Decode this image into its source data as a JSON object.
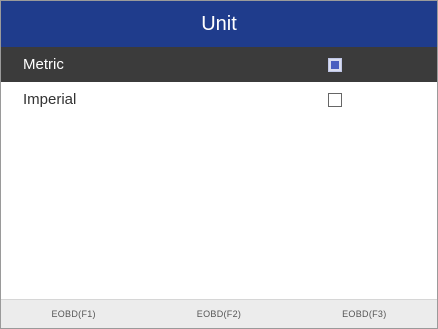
{
  "header": {
    "title": "Unit"
  },
  "options": [
    {
      "label": "Metric",
      "checked": true
    },
    {
      "label": "Imperial",
      "checked": false
    }
  ],
  "footer": {
    "keys": [
      "EOBD(F1)",
      "EOBD(F2)",
      "EOBD(F3)"
    ]
  },
  "colors": {
    "title_bar": "#1f3c8c",
    "selected_row": "#3b3b3b",
    "footer_bg": "#ececec"
  }
}
